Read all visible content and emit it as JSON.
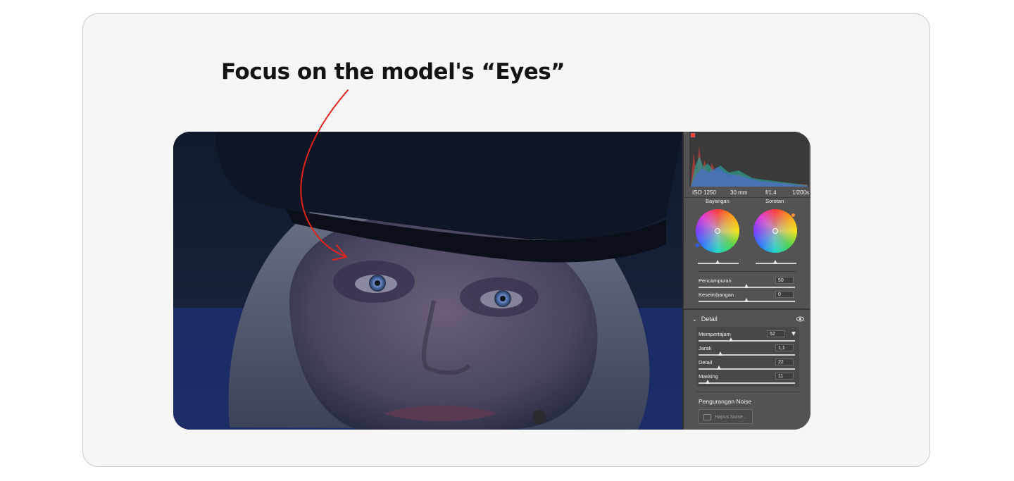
{
  "headline": "Focus on the model's “Eyes”",
  "annotation": {
    "color": "#e2231a",
    "icon": "curved-arrow-icon"
  },
  "photo": {
    "description_icon": "portrait-photo"
  },
  "panel": {
    "exif": {
      "iso": "ISO 1250",
      "focal": "30 mm",
      "aperture": "f/1,4",
      "shutter": "1/200s"
    },
    "color_grading": {
      "shadows_label": "Bayangan",
      "highlights_label": "Sorotan",
      "blending_label": "Pencampuran",
      "blending_value": "50",
      "balance_label": "Keseimbangan",
      "balance_value": "0"
    },
    "detail": {
      "section_label": "Detail",
      "sharpen_label": "Mempertajam",
      "sharpen_value": "52",
      "radius_label": "Jarak",
      "radius_value": "1,1",
      "detail_label": "Detail",
      "detail_value": "22",
      "masking_label": "Masking",
      "masking_value": "11",
      "noise_label": "Pengurangan Noise",
      "noise_button": "Hapus Noise..."
    }
  }
}
